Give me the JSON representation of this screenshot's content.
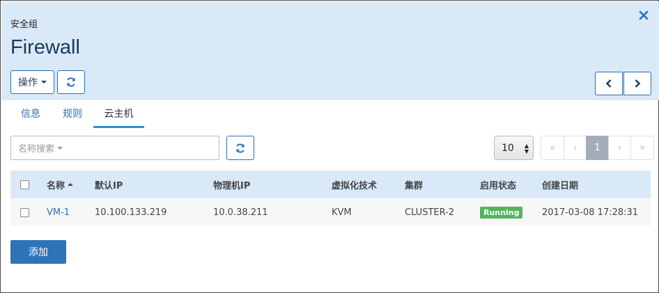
{
  "header": {
    "subtitle": "安全组",
    "title": "Firewall",
    "ops_label": "操作"
  },
  "tabs": [
    {
      "label": "信息"
    },
    {
      "label": "规则"
    },
    {
      "label": "云主机"
    }
  ],
  "active_tab": "云主机",
  "search": {
    "placeholder": "名称搜索"
  },
  "pagination": {
    "page_size": "10",
    "first": "«",
    "prev": "‹",
    "current": "1",
    "next": "›",
    "last": "»"
  },
  "table": {
    "columns": [
      "名称",
      "默认IP",
      "物理机IP",
      "虚拟化技术",
      "集群",
      "启用状态",
      "创建日期"
    ],
    "rows": [
      {
        "name": "VM-1",
        "default_ip": "10.100.133.219",
        "host_ip": "10.0.38.211",
        "hypervisor": "KVM",
        "cluster": "CLUSTER-2",
        "status": "Running",
        "created": "2017-03-08 17:28:31"
      }
    ]
  },
  "add_button": "添加",
  "colors": {
    "header_bg": "#d9e9f8",
    "accent": "#2b6eb5",
    "status_running": "#52b45c"
  },
  "icons": [
    "close-icon",
    "refresh-icon",
    "chevron-left-icon",
    "chevron-right-icon",
    "caret-down-icon",
    "sort-asc-icon"
  ]
}
